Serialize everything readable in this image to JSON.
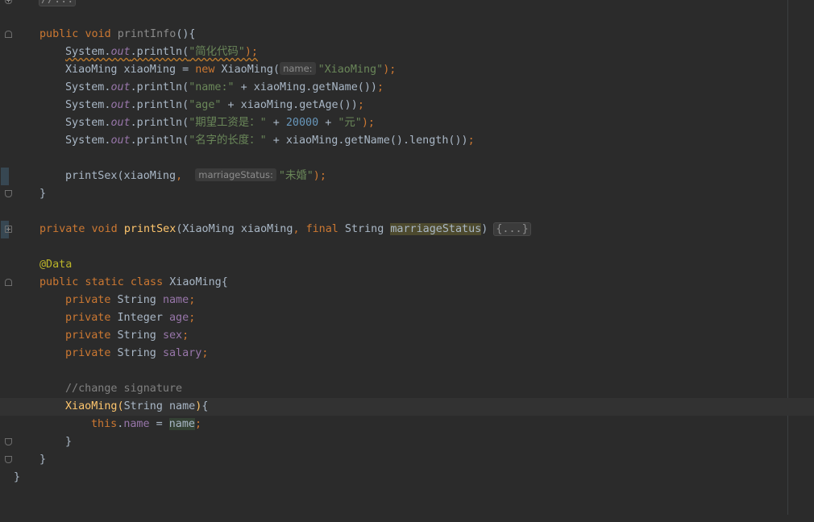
{
  "editor": {
    "lines": {
      "l0": "//...",
      "l2_kw1": "public",
      "l2_kw2": "void",
      "l2_name": "printInfo",
      "l2_rest": "(){",
      "l3_a": "System.",
      "l3_out": "out",
      "l3_b": ".println(",
      "l3_str": "\"简化代码\"",
      "l3_end": ");",
      "l4_a": "XiaoMing xiaoMing = ",
      "l4_kw": "new",
      "l4_b": " XiaoMing(",
      "l4_hint": "name:",
      "l4_str": "\"XiaoMing\"",
      "l4_end": ");",
      "l5_a": "System.",
      "l5_out": "out",
      "l5_b": ".println(",
      "l5_str": "\"name:\"",
      "l5_c": " + xiaoMing.getName())",
      "l5_end": ";",
      "l6_a": "System.",
      "l6_out": "out",
      "l6_b": ".println(",
      "l6_str": "\"age\"",
      "l6_c": " + xiaoMing.getAge())",
      "l6_end": ";",
      "l7_a": "System.",
      "l7_out": "out",
      "l7_b": ".println(",
      "l7_str": "\"期望工资是：\"",
      "l7_c": " + ",
      "l7_num": "20000",
      "l7_d": " + ",
      "l7_str2": "\"元\"",
      "l7_end": ");",
      "l8_a": "System.",
      "l8_out": "out",
      "l8_b": ".println(",
      "l8_str": "\"名字的长度：\"",
      "l8_c": " + xiaoMing.getName().length())",
      "l8_end": ";",
      "l10_a": "printSex(xiaoMing",
      "l10_comma": ",",
      "l10_hint": "marriageStatus:",
      "l10_str": "\"未婚\"",
      "l10_end": ");",
      "l11": "}",
      "l13_kw1": "private",
      "l13_kw2": "void",
      "l13_name": "printSex",
      "l13_a": "(XiaoMing xiaoMing",
      "l13_comma": ",",
      "l13_kw3": "final",
      "l13_b": " String ",
      "l13_param": "marriageStatus",
      "l13_c": ") ",
      "l13_fold": "{...}",
      "l15": "@Data",
      "l16_kw": "public static class",
      "l16_rest": " XiaoMing{",
      "l17_kw": "private",
      "l17_type": " String ",
      "l17_field": "name",
      "l17_end": ";",
      "l18_kw": "private",
      "l18_type": " Integer ",
      "l18_field": "age",
      "l18_end": ";",
      "l19_kw": "private",
      "l19_type": " String ",
      "l19_field": "sex",
      "l19_end": ";",
      "l20_kw": "private",
      "l20_type": " String ",
      "l20_field": "salary",
      "l20_end": ";",
      "l22": "//change signature",
      "l23_name": "XiaoMing",
      "l23_paren": "(",
      "l23_a": "String ",
      "l23_param": "name",
      "l23_close": ")",
      "l23_end": "{",
      "l24_kw": "this",
      "l24_dot": ".",
      "l24_field": "name",
      "l24_a": " = ",
      "l24_ref": "name",
      "l24_end": ";",
      "l25": "}",
      "l26": "}",
      "l27": "}"
    }
  },
  "icons": {
    "fold": "fold-icon",
    "bulb": "lightbulb-icon"
  },
  "colors": {
    "background": "#2b2b2b",
    "keyword": "#cc7832",
    "string": "#6a8759",
    "number": "#6897bb",
    "method": "#ffc66d",
    "field": "#9876aa",
    "comment": "#808080",
    "annotation": "#bbb529"
  }
}
